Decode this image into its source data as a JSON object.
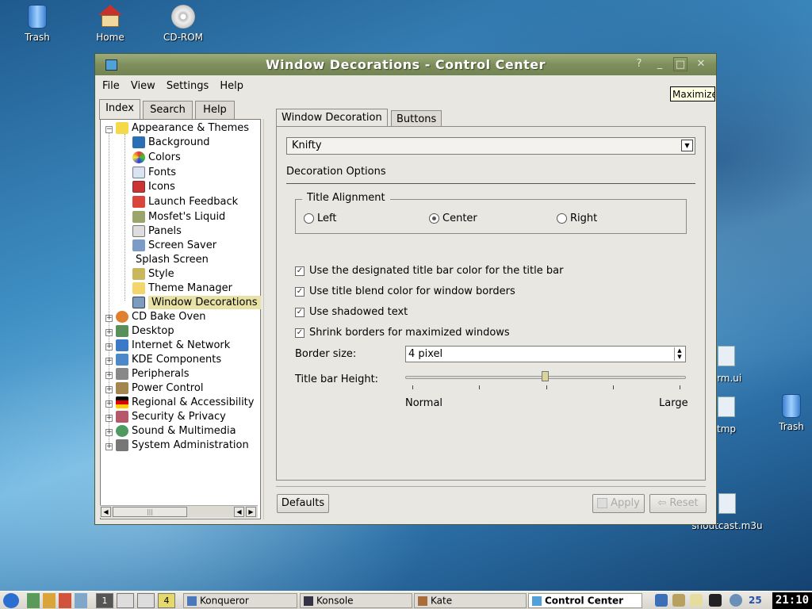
{
  "desktop": {
    "icons": [
      {
        "label": "Trash"
      },
      {
        "label": "Home"
      },
      {
        "label": "CD-ROM"
      },
      {
        "label": "Trash"
      }
    ],
    "partial_labels": [
      "orm.ui",
      "tmp",
      "shoutcast.m3u"
    ]
  },
  "window": {
    "title": "Window Decorations - Control Center",
    "controls": {
      "help": "?",
      "minimize": "_",
      "maximize": "□",
      "close": "✕"
    },
    "menu": [
      "File",
      "View",
      "Settings",
      "Help"
    ],
    "left_tabs": [
      "Index",
      "Search",
      "Help"
    ],
    "tree": [
      {
        "label": "Appearance & Themes",
        "expanded": true,
        "children": [
          {
            "label": "Background"
          },
          {
            "label": "Colors"
          },
          {
            "label": "Fonts"
          },
          {
            "label": "Icons"
          },
          {
            "label": "Launch Feedback"
          },
          {
            "label": "Mosfet's Liquid"
          },
          {
            "label": "Panels"
          },
          {
            "label": "Screen Saver"
          },
          {
            "label": "Splash Screen"
          },
          {
            "label": "Style"
          },
          {
            "label": "Theme Manager"
          },
          {
            "label": "Window Decorations",
            "selected": true
          }
        ]
      },
      {
        "label": "CD Bake Oven"
      },
      {
        "label": "Desktop"
      },
      {
        "label": "Internet & Network"
      },
      {
        "label": "KDE Components"
      },
      {
        "label": "Peripherals"
      },
      {
        "label": "Power Control"
      },
      {
        "label": "Regional & Accessibility"
      },
      {
        "label": "Security & Privacy"
      },
      {
        "label": "Sound & Multimedia"
      },
      {
        "label": "System Administration"
      }
    ],
    "right_tabs": [
      "Window Decoration",
      "Buttons"
    ],
    "decoration": {
      "selected": "Knifty",
      "options_label": "Decoration Options",
      "title_alignment": {
        "legend": "Title Alignment",
        "options": [
          "Left",
          "Center",
          "Right"
        ],
        "selected": "Center"
      },
      "checkboxes": [
        {
          "label": "Use the designated title bar color for the title bar",
          "checked": true
        },
        {
          "label": "Use title blend color for window borders",
          "checked": true
        },
        {
          "label": "Use shadowed text",
          "checked": true
        },
        {
          "label": "Shrink borders for maximized windows",
          "checked": true
        }
      ],
      "border_size": {
        "label": "Border size:",
        "value": "4 pixel"
      },
      "title_bar_height": {
        "label": "Title bar Height:",
        "min_label": "Normal",
        "max_label": "Large",
        "position": 0.5
      }
    },
    "buttons": {
      "defaults": "Defaults",
      "apply": "Apply",
      "reset": "Reset"
    }
  },
  "tooltip": "Maximize",
  "taskbar": {
    "pager": [
      "1",
      "",
      "",
      "4"
    ],
    "tasks": [
      {
        "label": "Konqueror"
      },
      {
        "label": "Konsole"
      },
      {
        "label": "Kate"
      },
      {
        "label": "Control Center",
        "active": true
      }
    ],
    "tray_number": "25",
    "clock": "21:10"
  },
  "colors": {
    "titlebar": "#7e8f5c",
    "selection": "#e8e2a6",
    "window_bg": "#e9e7e1"
  }
}
